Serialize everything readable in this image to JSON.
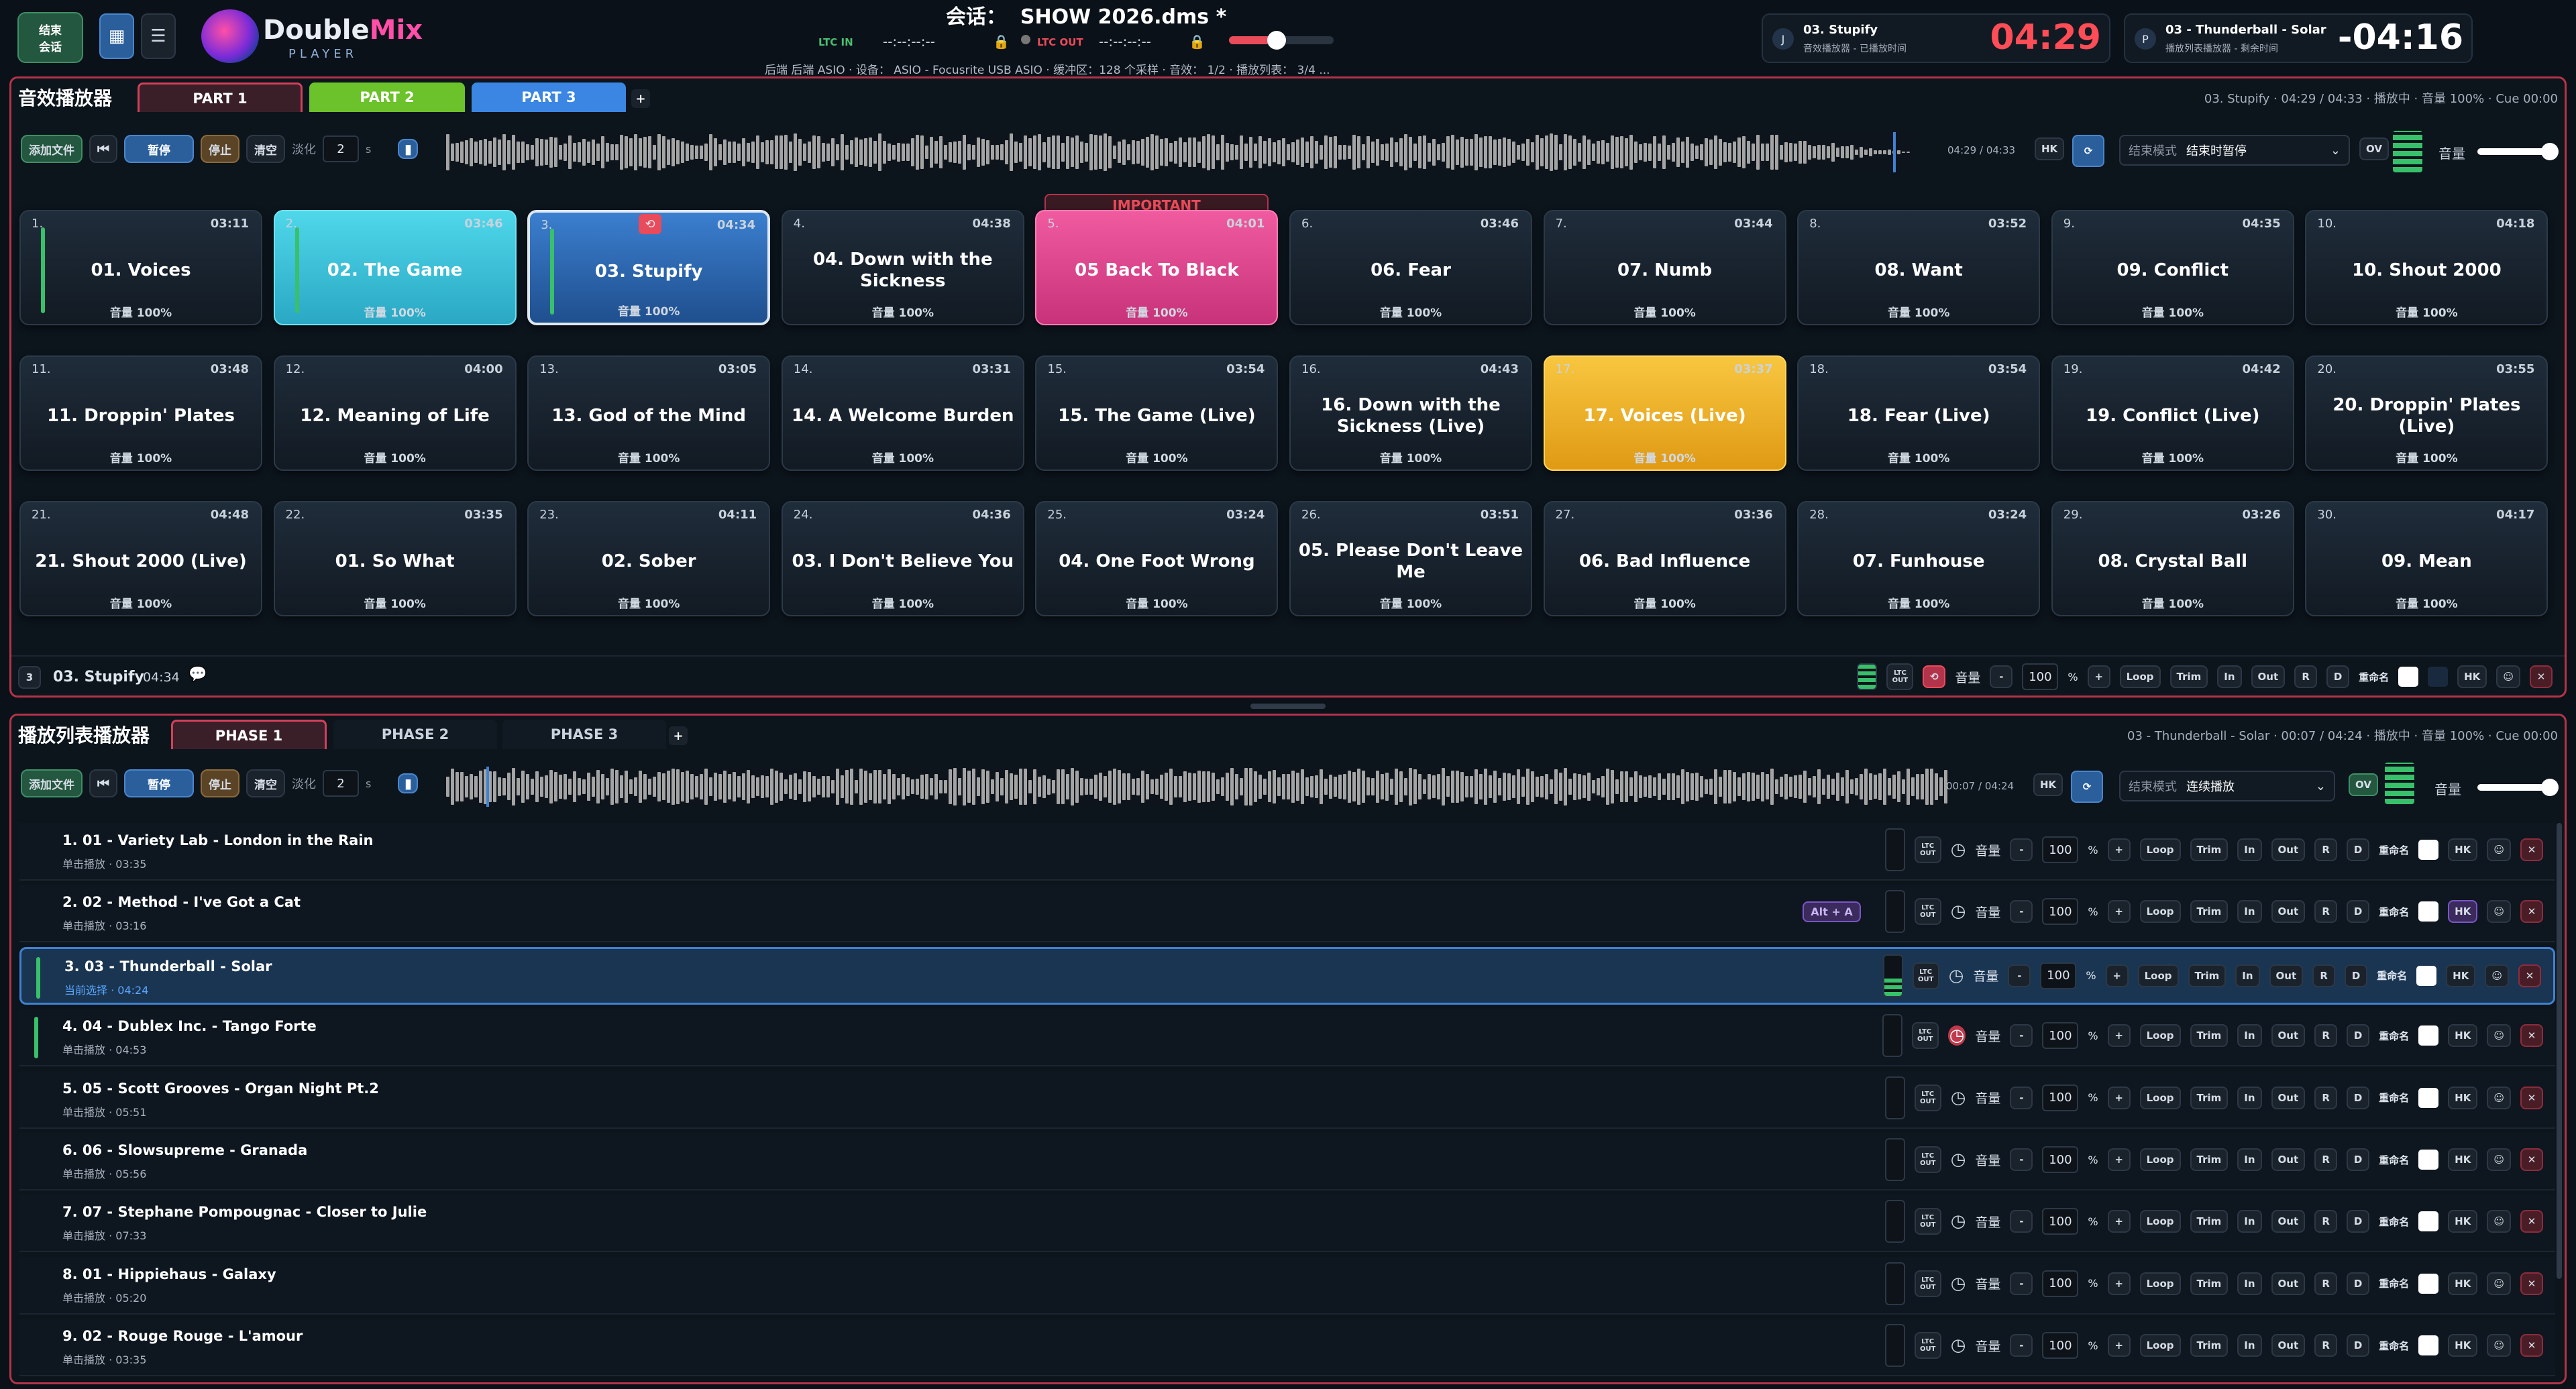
{
  "header": {
    "end_session_btn": "结束\n会话",
    "session_label": "会话：",
    "session_name": "SHOW 2026.dms *",
    "logo_a": "Double",
    "logo_b": "Mix",
    "logo_sub": "PLAYER",
    "ltc_in": "LTC IN",
    "ltc_in_val": "--:--:--:--",
    "ltc_out": "LTC OUT",
    "ltc_out_val": "--:--:--:--",
    "audio_info": "后端 后端 ASIO · 设备： ASIO - Focusrite USB ASIO · 缓冲区：128 个采样 · 音效： 1/2 · 播放列表： 3/4 ...",
    "np1_badge": "J",
    "np1_title": "03. Stupify",
    "np1_sub": "音效播放器 - 已播放时间",
    "np1_time": "04:29",
    "np2_badge": "P",
    "np2_title": "03 - Thunderball - Solar",
    "np2_sub": "播放列表播放器 - 剩余时间",
    "np2_time": "-04:16"
  },
  "sfx": {
    "title": "音效播放器",
    "tabs": [
      "PART 1",
      "PART 2",
      "PART 3"
    ],
    "status": "03. Stupify · 04:29 / 04:33 · 播放中 · 音量 100% · Cue 00:00",
    "toolbar": {
      "add": "添加文件",
      "pause": "暂停",
      "stop": "停止",
      "clear": "清空",
      "fade": "淡化",
      "fade_val": "2",
      "fade_unit": "s",
      "time": "04:29 / 04:33",
      "hk": "HK",
      "endmode_label": "结束模式",
      "endmode_val": "结束时暂停",
      "ov": "OV",
      "volume": "音量"
    },
    "important_tag": "IMPORTANT",
    "cues": [
      {
        "n": "1.",
        "d": "03:11",
        "t": "01. Voices",
        "v": "音量 100%",
        "s": "bar"
      },
      {
        "n": "2.",
        "d": "03:46",
        "t": "02. The Game",
        "v": "音量 100%",
        "s": "cyan"
      },
      {
        "n": "3.",
        "d": "04:34",
        "t": "03. Stupify",
        "v": "音量 100%",
        "s": "blue"
      },
      {
        "n": "4.",
        "d": "04:38",
        "t": "04. Down with the Sickness",
        "v": "音量 100%",
        "s": ""
      },
      {
        "n": "5.",
        "d": "04:01",
        "t": "05 Back To Black",
        "v": "音量 100%",
        "s": "pink"
      },
      {
        "n": "6.",
        "d": "03:46",
        "t": "06. Fear",
        "v": "音量 100%",
        "s": ""
      },
      {
        "n": "7.",
        "d": "03:44",
        "t": "07. Numb",
        "v": "音量 100%",
        "s": ""
      },
      {
        "n": "8.",
        "d": "03:52",
        "t": "08. Want",
        "v": "音量 100%",
        "s": ""
      },
      {
        "n": "9.",
        "d": "04:35",
        "t": "09. Conflict",
        "v": "音量 100%",
        "s": ""
      },
      {
        "n": "10.",
        "d": "04:18",
        "t": "10. Shout 2000",
        "v": "音量 100%",
        "s": ""
      },
      {
        "n": "11.",
        "d": "03:48",
        "t": "11. Droppin' Plates",
        "v": "音量 100%",
        "s": ""
      },
      {
        "n": "12.",
        "d": "04:00",
        "t": "12. Meaning of Life",
        "v": "音量 100%",
        "s": ""
      },
      {
        "n": "13.",
        "d": "03:05",
        "t": "13. God of the Mind",
        "v": "音量 100%",
        "s": ""
      },
      {
        "n": "14.",
        "d": "03:31",
        "t": "14. A Welcome Burden",
        "v": "音量 100%",
        "s": ""
      },
      {
        "n": "15.",
        "d": "03:54",
        "t": "15. The Game (Live)",
        "v": "音量 100%",
        "s": ""
      },
      {
        "n": "16.",
        "d": "04:43",
        "t": "16. Down with the Sickness (Live)",
        "v": "音量 100%",
        "s": ""
      },
      {
        "n": "17.",
        "d": "03:37",
        "t": "17. Voices (Live)",
        "v": "音量 100%",
        "s": "yellow"
      },
      {
        "n": "18.",
        "d": "03:54",
        "t": "18. Fear (Live)",
        "v": "音量 100%",
        "s": ""
      },
      {
        "n": "19.",
        "d": "04:42",
        "t": "19. Conflict (Live)",
        "v": "音量 100%",
        "s": ""
      },
      {
        "n": "20.",
        "d": "03:55",
        "t": "20. Droppin' Plates (Live)",
        "v": "音量 100%",
        "s": ""
      },
      {
        "n": "21.",
        "d": "04:48",
        "t": "21. Shout 2000 (Live)",
        "v": "音量 100%",
        "s": ""
      },
      {
        "n": "22.",
        "d": "03:35",
        "t": "01. So What",
        "v": "音量 100%",
        "s": ""
      },
      {
        "n": "23.",
        "d": "04:11",
        "t": "02. Sober",
        "v": "音量 100%",
        "s": ""
      },
      {
        "n": "24.",
        "d": "04:36",
        "t": "03. I Don't Believe You",
        "v": "音量 100%",
        "s": ""
      },
      {
        "n": "25.",
        "d": "03:24",
        "t": "04. One Foot Wrong",
        "v": "音量 100%",
        "s": ""
      },
      {
        "n": "26.",
        "d": "03:51",
        "t": "05. Please Don't Leave Me",
        "v": "音量 100%",
        "s": ""
      },
      {
        "n": "27.",
        "d": "03:36",
        "t": "06. Bad Influence",
        "v": "音量 100%",
        "s": ""
      },
      {
        "n": "28.",
        "d": "03:24",
        "t": "07. Funhouse",
        "v": "音量 100%",
        "s": ""
      },
      {
        "n": "29.",
        "d": "03:26",
        "t": "08. Crystal Ball",
        "v": "音量 100%",
        "s": ""
      },
      {
        "n": "30.",
        "d": "04:17",
        "t": "09. Mean",
        "v": "音量 100%",
        "s": ""
      }
    ],
    "footer": {
      "num": "3",
      "title": "03. Stupify",
      "dur": "04:34",
      "volume": "音量",
      "vol_val": "100",
      "pct": "%",
      "loop": "Loop",
      "trim": "Trim",
      "in": "In",
      "out": "Out",
      "r": "R",
      "d": "D",
      "rename": "重命名",
      "hk": "HK",
      "ltc": "LTC OUT"
    }
  },
  "playlist": {
    "title": "播放列表播放器",
    "tabs": [
      "PHASE 1",
      "PHASE 2",
      "PHASE 3"
    ],
    "status": "03 - Thunderball - Solar · 00:07 / 04:24 · 播放中 · 音量 100% · Cue 00:00",
    "toolbar": {
      "add": "添加文件",
      "pause": "暂停",
      "stop": "停止",
      "clear": "清空",
      "fade": "淡化",
      "fade_val": "2",
      "fade_unit": "s",
      "time": "00:07 / 04:24",
      "hk": "HK",
      "endmode_label": "结束模式",
      "endmode_val": "连续播放",
      "ov": "OV",
      "volume": "音量"
    },
    "controls": {
      "ltc": "LTC OUT",
      "volume": "音量",
      "vol_val": "100",
      "pct": "%",
      "loop": "Loop",
      "trim": "Trim",
      "in": "In",
      "out": "Out",
      "r": "R",
      "d": "D",
      "rename": "重命名",
      "hk": "HK",
      "minus": "-",
      "plus": "+"
    },
    "hotkey_badge": "Alt + A",
    "rows": [
      {
        "t": "1. 01 - Variety Lab - London in the Rain",
        "s": "单击播放 · 03:35",
        "sel": false
      },
      {
        "t": "2. 02 - Method - I've Got a Cat",
        "s": "单击播放 · 03:16",
        "sel": false
      },
      {
        "t": "3. 03 - Thunderball - Solar",
        "s": "当前选择 · 04:24",
        "sel": true
      },
      {
        "t": "4. 04 - Dublex Inc. - Tango Forte",
        "s": "单击播放 · 04:53",
        "sel": false
      },
      {
        "t": "5. 05 - Scott Grooves - Organ Night Pt.2",
        "s": "单击播放 · 05:51",
        "sel": false
      },
      {
        "t": "6. 06 - Slowsupreme - Granada",
        "s": "单击播放 · 05:56",
        "sel": false
      },
      {
        "t": "7. 07 - Stephane Pompougnac - Closer to Julie",
        "s": "单击播放 · 07:33",
        "sel": false
      },
      {
        "t": "8. 01 - Hippiehaus - Galaxy",
        "s": "单击播放 · 05:20",
        "sel": false
      },
      {
        "t": "9. 02 - Rouge Rouge - L'amour",
        "s": "单击播放 · 03:35",
        "sel": false
      }
    ]
  },
  "colors": {
    "accent": "#b3344a",
    "cyan": "#3ec8df",
    "blue": "#2b6db5",
    "pink": "#e0478f",
    "yellow": "#f0b428",
    "green": "#38c06a",
    "important": "#e94b5b"
  },
  "progress": {
    "sfx_fraction": 0.985,
    "playlist_fraction": 0.027,
    "header_volume_fraction": 0.45,
    "sfx_volume_fraction": 0.9,
    "playlist_volume_fraction": 0.9
  }
}
